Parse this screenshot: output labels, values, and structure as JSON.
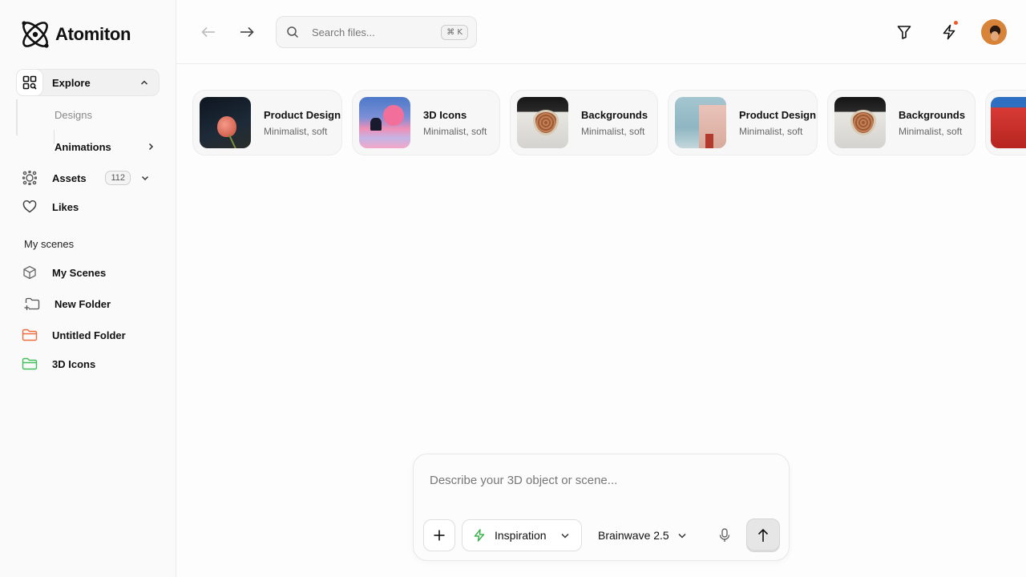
{
  "app": {
    "name": "Atomiton"
  },
  "sidebar": {
    "explore": {
      "label": "Explore",
      "expanded": true
    },
    "explore_sub": [
      {
        "label": "Designs"
      },
      {
        "label": "Animations"
      }
    ],
    "assets": {
      "label": "Assets",
      "count": "112"
    },
    "likes": {
      "label": "Likes"
    },
    "section_title": "My scenes",
    "scenes": [
      {
        "label": "My Scenes",
        "icon": "cube-icon"
      },
      {
        "label": "New Folder",
        "icon": "folder-plus-icon"
      },
      {
        "label": "Untitled Folder",
        "icon": "folder-icon",
        "color": "#ef6a3c"
      },
      {
        "label": "3D Icons",
        "icon": "folder-icon",
        "color": "#3fbf5a"
      }
    ]
  },
  "topbar": {
    "search": {
      "placeholder": "Search files...",
      "shortcut": "⌘ K"
    },
    "notification_color": "#ef5a2c"
  },
  "cards": [
    {
      "title": "Product Design",
      "subtitle": "Minimalist, soft"
    },
    {
      "title": "3D Icons",
      "subtitle": "Minimalist, soft"
    },
    {
      "title": "Backgrounds",
      "subtitle": "Minimalist, soft"
    },
    {
      "title": "Product Design",
      "subtitle": "Minimalist, soft"
    },
    {
      "title": "Backgrounds",
      "subtitle": "Minimalist, soft"
    },
    {
      "title": "",
      "subtitle": ""
    }
  ],
  "prompt": {
    "placeholder": "Describe your 3D object or scene...",
    "inspiration_label": "Inspiration",
    "model_label": "Brainwave 2.5",
    "accent": "#3fb34f"
  }
}
